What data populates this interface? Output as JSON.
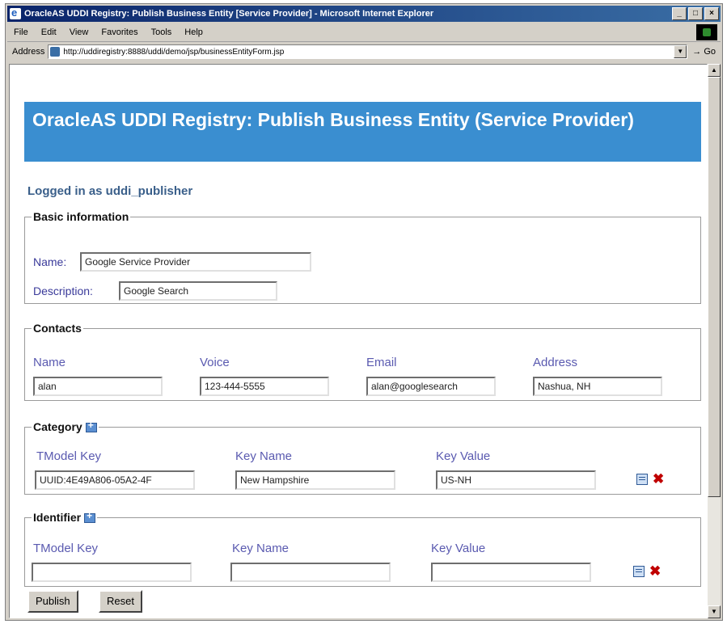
{
  "window": {
    "title": "OracleAS UDDI Registry: Publish Business Entity [Service Provider] - Microsoft Internet Explorer",
    "controls": {
      "minimize": "_",
      "maximize": "□",
      "close": "×"
    }
  },
  "menu": [
    "File",
    "Edit",
    "View",
    "Favorites",
    "Tools",
    "Help"
  ],
  "address": {
    "label": "Address",
    "url": "http://uddiregistry:8888/uddi/demo/jsp/businessEntityForm.jsp",
    "go_label": "Go"
  },
  "page": {
    "banner": "OracleAS UDDI Registry: Publish Business Entity (Service Provider)",
    "logged_in": "Logged in as uddi_publisher",
    "basic": {
      "legend": "Basic information",
      "name_label": "Name:",
      "name_value": "Google Service Provider",
      "description_label": "Description:",
      "description_value": "Google Search"
    },
    "contacts": {
      "legend": "Contacts",
      "columns": [
        "Name",
        "Voice",
        "Email",
        "Address"
      ],
      "values": [
        "alan",
        "123-444-5555",
        "alan@googlesearch",
        "Nashua, NH"
      ]
    },
    "category": {
      "legend": "Category",
      "columns": [
        "TModel Key",
        "Key Name",
        "Key Value"
      ],
      "values": [
        "UUID:4E49A806-05A2-4F",
        "New Hampshire",
        "US-NH"
      ]
    },
    "identifier": {
      "legend": "Identifier",
      "columns": [
        "TModel Key",
        "Key Name",
        "Key Value"
      ],
      "values": [
        "",
        "",
        ""
      ]
    },
    "buttons": {
      "publish": "Publish",
      "reset": "Reset"
    }
  },
  "icons": {
    "add": "add-icon",
    "edit": "edit-row-icon",
    "delete": "delete-icon"
  },
  "colors": {
    "banner_bg": "#3a8ed0",
    "label_blue": "#3a3a9a",
    "delete_red": "#c00000"
  }
}
